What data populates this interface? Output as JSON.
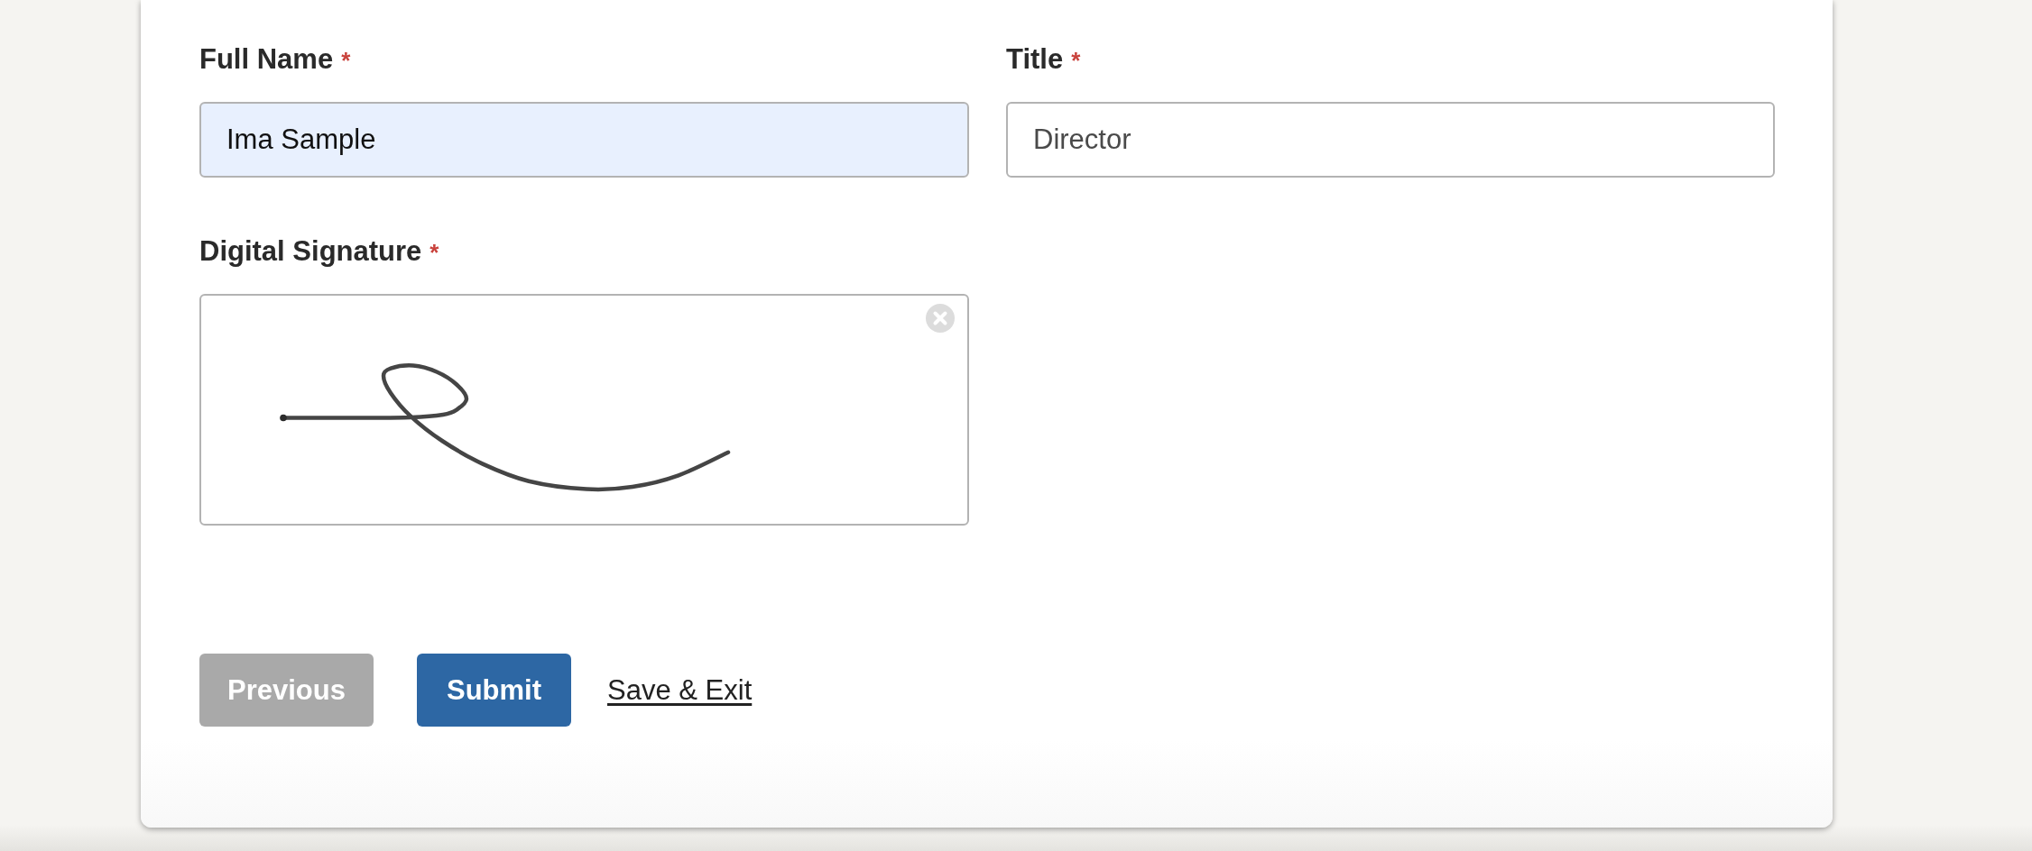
{
  "form": {
    "fields": [
      {
        "kind": "text",
        "label": "Full Name",
        "required_mark": "*",
        "value": "Ima Sample",
        "autofilled": true
      },
      {
        "kind": "text",
        "label": "Title",
        "required_mark": "*",
        "value": "Director",
        "autofilled": false
      },
      {
        "kind": "signature",
        "label": "Digital Signature",
        "required_mark": "*",
        "signed": true
      }
    ],
    "actions": [
      {
        "kind": "secondary",
        "label": "Previous"
      },
      {
        "kind": "primary",
        "label": "Submit"
      },
      {
        "kind": "link",
        "label": "Save & Exit"
      }
    ]
  }
}
